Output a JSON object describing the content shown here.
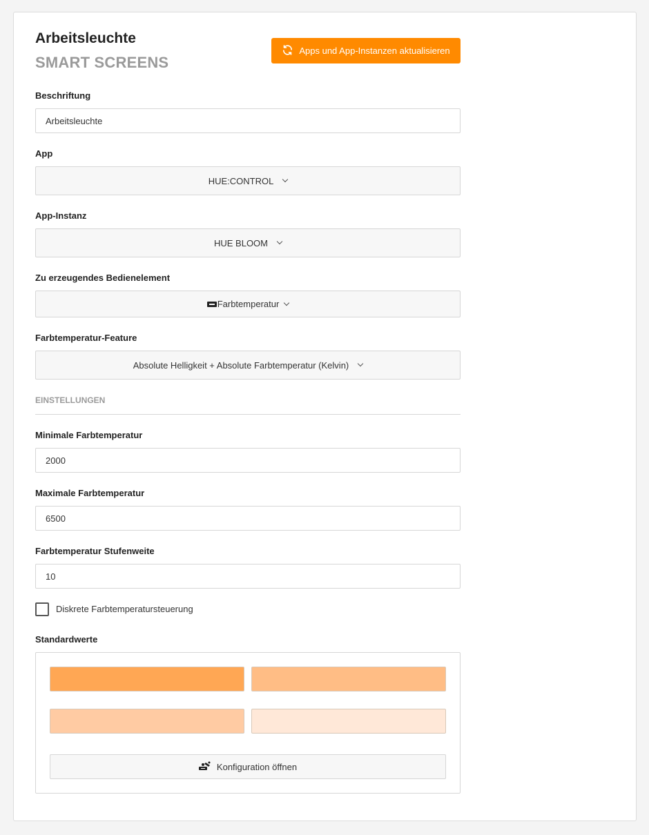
{
  "header": {
    "title": "Arbeitsleuchte",
    "subtitle": "SMART SCREENS",
    "refresh_label": "Apps und App-Instanzen aktualisieren",
    "refresh_icon": "refresh-icon"
  },
  "accent_color": "#ff8a00",
  "fields": {
    "caption": {
      "label": "Beschriftung",
      "value": "Arbeitsleuchte"
    },
    "app": {
      "label": "App",
      "value": "HUE:CONTROL"
    },
    "app_instance": {
      "label": "App-Instanz",
      "value": "HUE BLOOM"
    },
    "control_element": {
      "label": "Zu erzeugendes Bedienelement",
      "value": "Farbtemperatur",
      "icon": "control-slider-icon"
    },
    "color_temp_feature": {
      "label": "Farbtemperatur-Feature",
      "value": "Absolute Helligkeit + Absolute Farbtemperatur (Kelvin)"
    }
  },
  "settings": {
    "heading": "EINSTELLUNGEN",
    "min_temp": {
      "label": "Minimale Farbtemperatur",
      "value": "2000"
    },
    "max_temp": {
      "label": "Maximale Farbtemperatur",
      "value": "6500"
    },
    "step": {
      "label": "Farbtemperatur Stufenweite",
      "value": "10"
    },
    "discrete": {
      "label": "Diskrete Farbtemperatursteuerung",
      "checked": false
    }
  },
  "defaults": {
    "label": "Standardwerte",
    "swatches": [
      "#ffa754",
      "#ffbd85",
      "#ffcba3",
      "#ffe8d8"
    ],
    "config_label": "Konfiguration öffnen",
    "config_icon": "configure-icon"
  }
}
